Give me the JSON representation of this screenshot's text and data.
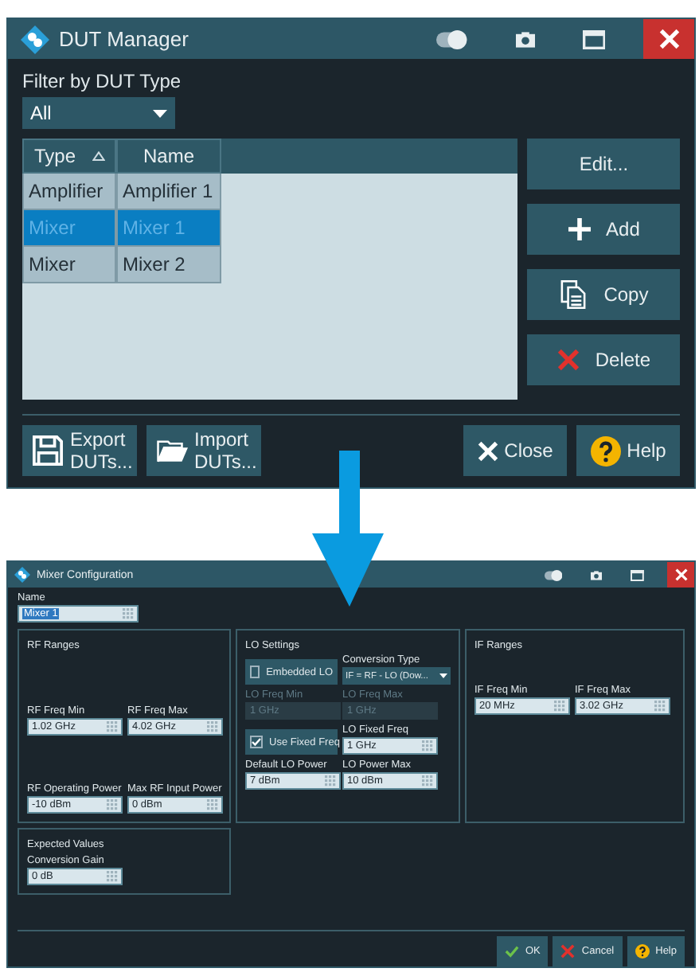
{
  "dut_manager": {
    "title": "DUT Manager",
    "filter": {
      "label": "Filter by DUT Type",
      "value": "All"
    },
    "table": {
      "columns": [
        {
          "label": "Type",
          "sorted": true
        },
        {
          "label": "Name",
          "sorted": false
        }
      ],
      "rows": [
        {
          "cells": [
            "Amplifier",
            "Amplifier 1"
          ],
          "selected": false
        },
        {
          "cells": [
            "Mixer",
            "Mixer 1"
          ],
          "selected": true
        },
        {
          "cells": [
            "Mixer",
            "Mixer 2"
          ],
          "selected": false
        }
      ]
    },
    "side_buttons": [
      {
        "label": "Edit...",
        "kind": "edit"
      },
      {
        "label": "Add",
        "kind": "add"
      },
      {
        "label": "Copy",
        "kind": "copy"
      },
      {
        "label": "Delete",
        "kind": "delete"
      }
    ],
    "file_buttons": [
      {
        "label": "Export DUTs...",
        "kind": "export"
      },
      {
        "label": "Import DUTs...",
        "kind": "import"
      }
    ],
    "dialog_buttons": [
      {
        "label": "Close",
        "kind": "close"
      },
      {
        "label": "Help",
        "kind": "help"
      }
    ]
  },
  "mixer_configuration": {
    "title": "Mixer Configuration",
    "name": {
      "label": "Name",
      "value": "Mixer 1",
      "selected": true
    },
    "rf_ranges": {
      "title": "RF Ranges",
      "fields": [
        {
          "label": "RF Freq Min",
          "value": "1.02 GHz"
        },
        {
          "label": "RF Freq Max",
          "value": "4.02 GHz"
        },
        {
          "label": "RF Operating Power",
          "value": "-10 dBm"
        },
        {
          "label": "Max RF Input Power",
          "value": "0 dBm"
        }
      ]
    },
    "lo_settings": {
      "title": "LO Settings",
      "items": [
        {
          "kind": "checkbox",
          "label": "Embedded LO",
          "checked": false
        },
        {
          "kind": "dropdown",
          "label": "Conversion Type",
          "value": "IF = RF - LO (Dow..."
        },
        {
          "kind": "field",
          "label": "LO Freq Min",
          "value": "1 GHz",
          "disabled": true
        },
        {
          "kind": "field",
          "label": "LO Freq Max",
          "value": "1 GHz",
          "disabled": true
        },
        {
          "kind": "checkbox",
          "label": "Use Fixed Freq",
          "checked": true
        },
        {
          "kind": "field",
          "label": "LO Fixed Freq",
          "value": "1 GHz",
          "disabled": false
        },
        {
          "kind": "field",
          "label": "Default LO Power",
          "value": "7 dBm",
          "disabled": false
        },
        {
          "kind": "field",
          "label": "LO Power Max",
          "value": "10 dBm",
          "disabled": false
        }
      ]
    },
    "if_ranges": {
      "title": "IF Ranges",
      "fields": [
        {
          "label": "IF Freq Min",
          "value": "20 MHz"
        },
        {
          "label": "IF Freq Max",
          "value": "3.02 GHz"
        }
      ]
    },
    "expected_values": {
      "title": "Expected Values",
      "fields": [
        {
          "label": "Conversion Gain",
          "value": "0 dB"
        }
      ]
    },
    "buttons": [
      {
        "label": "OK",
        "kind": "ok"
      },
      {
        "label": "Cancel",
        "kind": "cancel"
      },
      {
        "label": "Help",
        "kind": "help"
      }
    ]
  }
}
